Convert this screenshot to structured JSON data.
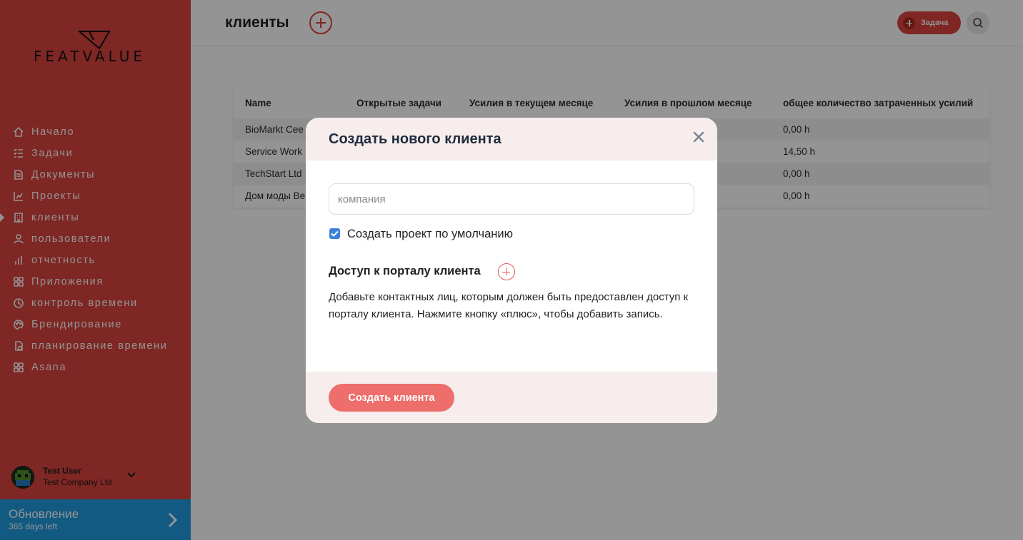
{
  "app": {
    "brand": "FEATVALUE",
    "accent_color": "#d9443f"
  },
  "sidebar": {
    "items": [
      {
        "label": "Начало",
        "icon": "home-icon"
      },
      {
        "label": "Задачи",
        "icon": "tasks-icon"
      },
      {
        "label": "Документы",
        "icon": "documents-icon"
      },
      {
        "label": "Проекты",
        "icon": "projects-icon"
      },
      {
        "label": "клиенты",
        "icon": "clients-icon",
        "active": true
      },
      {
        "label": "пользователи",
        "icon": "users-icon"
      },
      {
        "label": "отчетность",
        "icon": "reporting-icon"
      },
      {
        "label": "Приложения",
        "icon": "apps-icon"
      },
      {
        "label": "контроль времени",
        "icon": "time-tracking-icon"
      },
      {
        "label": "Брендирование",
        "icon": "branding-icon"
      },
      {
        "label": "планирование времени",
        "icon": "time-planning-icon"
      },
      {
        "label": "Asana",
        "icon": "asana-icon"
      }
    ],
    "user": {
      "name": "Test User",
      "company": "Test Company Ltd"
    },
    "upgrade": {
      "title": "Обновление",
      "subtitle": "365 days left"
    }
  },
  "header": {
    "title": "клиенты",
    "task_button_label": "Задача"
  },
  "table": {
    "columns": [
      "Name",
      "Открытые задачи",
      "Усилия в текущем месяце",
      "Усилия в прошлом месяце",
      "общее количество затраченных усилий"
    ],
    "rows": [
      {
        "name": "BioMarkt Cee",
        "open_tasks": "",
        "current_month": "",
        "last_month": "",
        "total": "0,00 h"
      },
      {
        "name": "Service Work",
        "open_tasks": "",
        "current_month": "",
        "last_month": "",
        "total": "14,50 h"
      },
      {
        "name": "TechStart Ltd",
        "open_tasks": "",
        "current_month": "",
        "last_month": "",
        "total": "0,00 h"
      },
      {
        "name": "Дом моды Be",
        "open_tasks": "",
        "current_month": "",
        "last_month": "",
        "total": "0,00 h"
      }
    ]
  },
  "modal": {
    "title": "Создать нового клиента",
    "company_input": {
      "placeholder": "компания",
      "value": ""
    },
    "default_project_checkbox": {
      "label": "Создать проект по умолчанию",
      "checked": true
    },
    "access_title": "Доступ к порталу клиента",
    "access_description": "Добавьте контактных лиц, которым должен быть предоставлен доступ к порталу клиента. Нажмите кнопку «плюс», чтобы добавить запись.",
    "submit_label": "Создать клиента"
  }
}
